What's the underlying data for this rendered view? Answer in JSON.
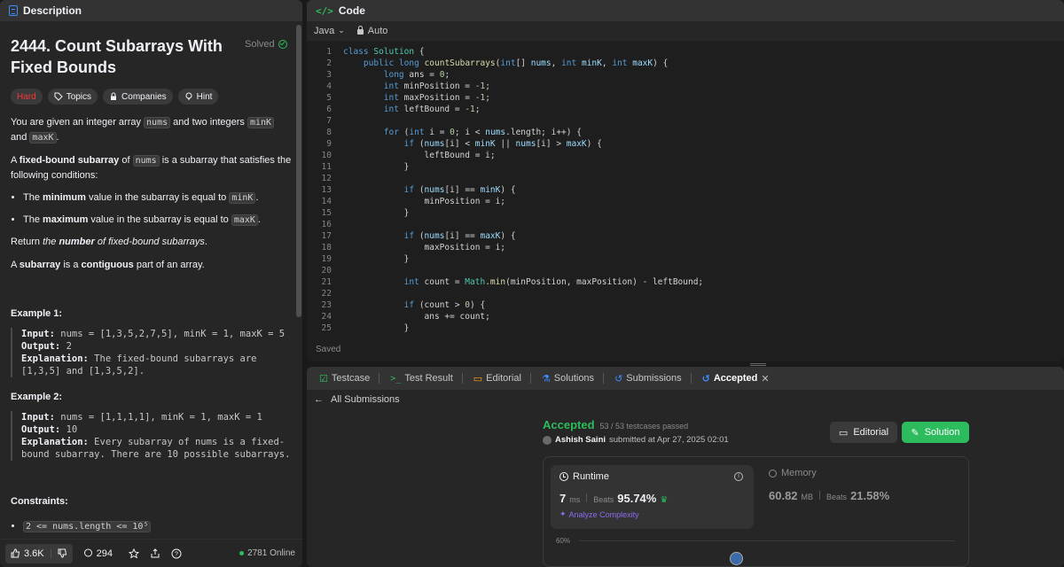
{
  "description": {
    "tab_label": "Description",
    "title": "2444. Count Subarrays With Fixed Bounds",
    "status": "Solved",
    "tags": [
      "Hard",
      "Topics",
      "Companies",
      "Hint"
    ],
    "p1_a": "You are given an integer array ",
    "p1_code1": "nums",
    "p1_b": " and two integers ",
    "p1_code2": "minK",
    "p1_c": " and ",
    "p1_code3": "maxK",
    "p1_d": ".",
    "p2_a": "A ",
    "p2_bold": "fixed-bound subarray",
    "p2_b": " of ",
    "p2_code": "nums",
    "p2_c": " is a subarray that satisfies the following conditions:",
    "b1_a": "The ",
    "b1_bold": "minimum",
    "b1_b": " value in the subarray is equal to ",
    "b1_code": "minK",
    "b1_c": ".",
    "b2_a": "The ",
    "b2_bold": "maximum",
    "b2_b": " value in the subarray is equal to ",
    "b2_code": "maxK",
    "b2_c": ".",
    "p3_a": "Return ",
    "p3_em": "the ",
    "p3_strong": "number",
    "p3_em2": " of fixed-bound subarrays",
    "p3_b": ".",
    "p4_a": "A ",
    "p4_bold": "subarray",
    "p4_b": " is a ",
    "p4_bold2": "contiguous",
    "p4_c": " part of an array.",
    "ex1_title": "Example 1:",
    "ex1_input_label": "Input:",
    "ex1_input": " nums = [1,3,5,2,7,5], minK = 1, maxK = 5",
    "ex1_output_label": "Output:",
    "ex1_output": " 2",
    "ex1_expl_label": "Explanation:",
    "ex1_expl": " The fixed-bound subarrays are [1,3,5] and [1,3,5,2].",
    "ex2_title": "Example 2:",
    "ex2_input_label": "Input:",
    "ex2_input": " nums = [1,1,1,1], minK = 1, maxK = 1",
    "ex2_output_label": "Output:",
    "ex2_output": " 10",
    "ex2_expl_label": "Explanation:",
    "ex2_expl": " Every subarray of nums is a fixed-bound subarray. There are 10 possible subarrays.",
    "constraints_title": "Constraints:",
    "constraint1": "2 <= nums.length <= 10⁵"
  },
  "footer": {
    "likes": "3.6K",
    "comments": "294",
    "online": "2781 Online"
  },
  "code": {
    "tab_label": "Code",
    "language": "Java",
    "mode": "Auto",
    "saved": "Saved",
    "lines": [
      "class Solution {",
      "    public long countSubarrays(int[] nums, int minK, int maxK) {",
      "        long ans = 0;",
      "        int minPosition = -1;",
      "        int maxPosition = -1;",
      "        int leftBound = -1;",
      "",
      "        for (int i = 0; i < nums.length; i++) {",
      "            if (nums[i] < minK || nums[i] > maxK) {",
      "                leftBound = i;",
      "            }",
      "",
      "            if (nums[i] == minK) {",
      "                minPosition = i;",
      "            }",
      "",
      "            if (nums[i] == maxK) {",
      "                maxPosition = i;",
      "            }",
      "",
      "            int count = Math.min(minPosition, maxPosition) - leftBound;",
      "",
      "            if (count > 0) {",
      "                ans += count;",
      "            }"
    ]
  },
  "bottom": {
    "tabs": [
      "Testcase",
      "Test Result",
      "Editorial",
      "Solutions",
      "Submissions",
      "Accepted"
    ],
    "back_label": "All Submissions",
    "accepted": "Accepted",
    "testcases": "53 / 53 testcases passed",
    "author": "Ashish Saini",
    "submitted": "submitted at Apr 27, 2025 02:01",
    "editorial_btn": "Editorial",
    "solution_btn": "Solution",
    "runtime_label": "Runtime",
    "runtime_value": "7",
    "runtime_unit": "ms",
    "beats_label": "Beats",
    "runtime_beats": "95.74%",
    "analyze": "Analyze Complexity",
    "memory_label": "Memory",
    "memory_value": "60.82",
    "memory_unit": "MB",
    "memory_beats": "21.58%",
    "chart_tick": "60%"
  },
  "colors": {
    "accent_green": "#2cbb5d",
    "hard_red": "#f63737",
    "link_blue": "#3c8dff",
    "analyze_purple": "#8d6cf0"
  }
}
